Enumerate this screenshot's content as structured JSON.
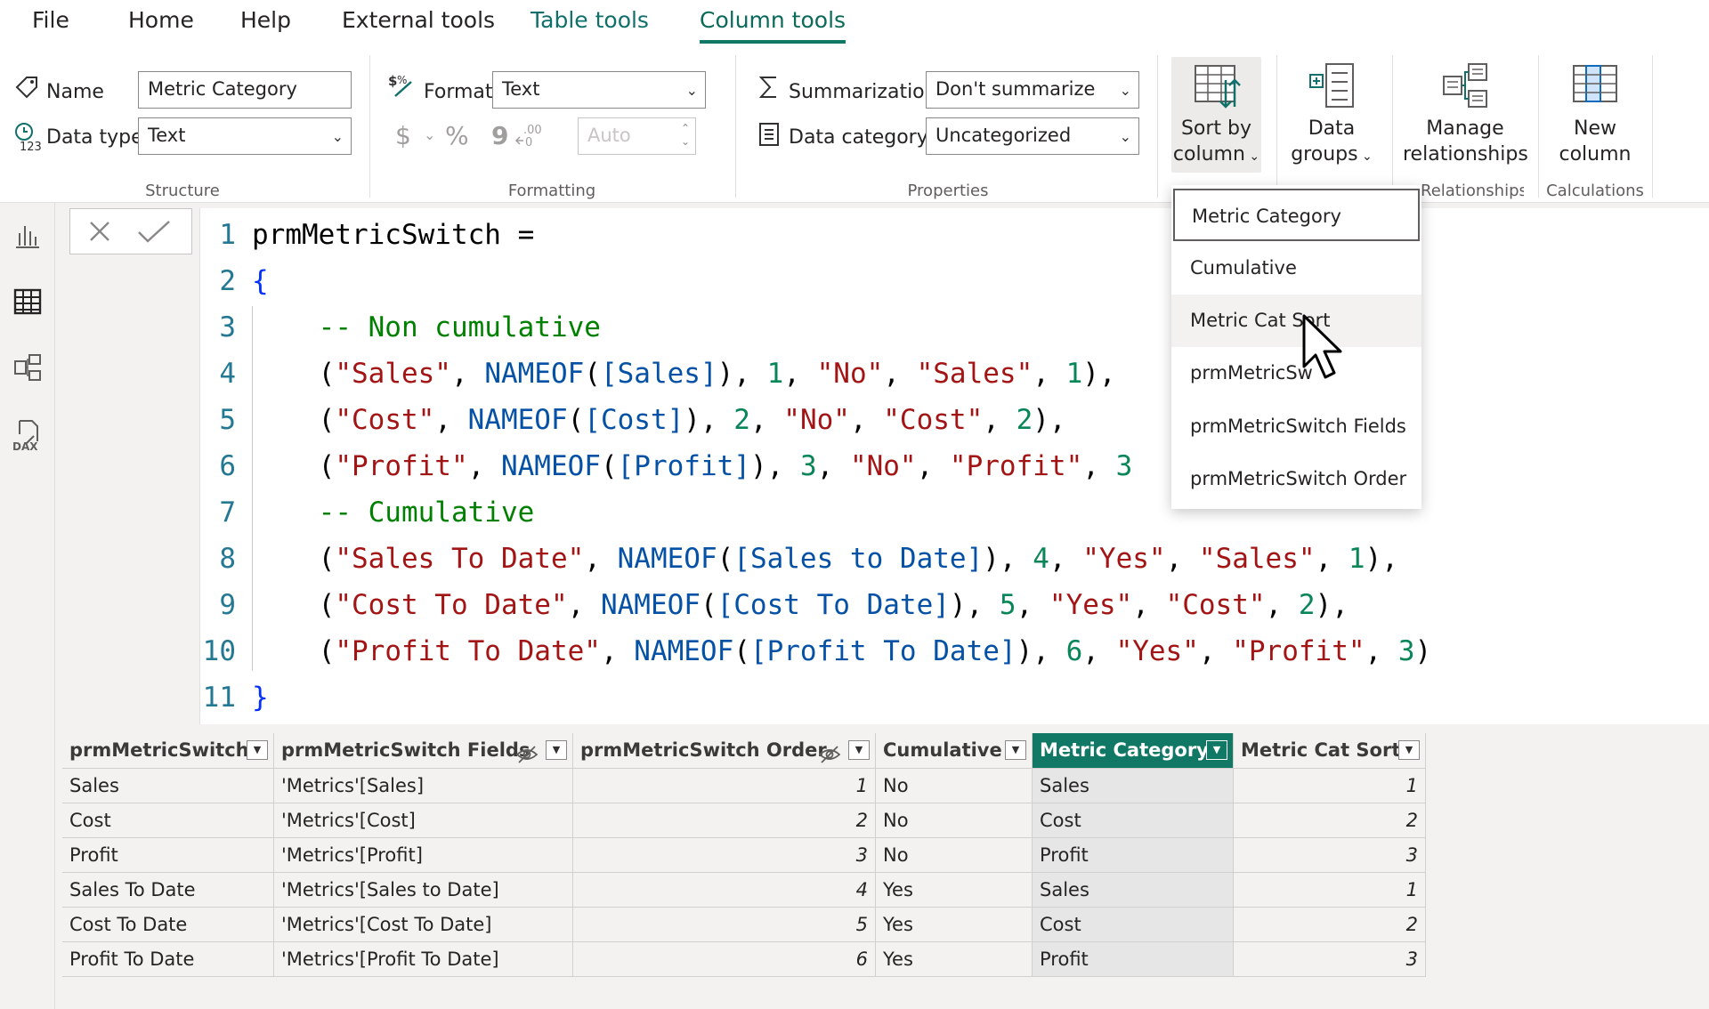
{
  "menu": {
    "items": [
      "File",
      "Home",
      "Help",
      "External tools",
      "Table tools",
      "Column tools"
    ]
  },
  "ribbon": {
    "structure": {
      "group_label": "Structure",
      "name_label": "Name",
      "name_value": "Metric Category",
      "datatype_label": "Data type",
      "datatype_value": "Text"
    },
    "formatting": {
      "group_label": "Formatting",
      "format_label": "Format",
      "format_value": "Text",
      "currency_symbol": "$",
      "percent_symbol": "%",
      "comma_symbol": "9",
      "auto_value": "Auto"
    },
    "properties": {
      "group_label": "Properties",
      "summarization_label": "Summarization",
      "summarization_value": "Don't summarize",
      "datacategory_label": "Data category",
      "datacategory_value": "Uncategorized"
    },
    "sort": {
      "line1": "Sort by",
      "line2": "column"
    },
    "groups": {
      "line1": "Data",
      "line2": "groups"
    },
    "relationships": {
      "line1": "Manage",
      "line2": "relationships",
      "group_label": "Relationships"
    },
    "calculations": {
      "line1": "New",
      "line2": "column",
      "group_label": "Calculations"
    }
  },
  "sort_dropdown": {
    "items": [
      "Metric Category",
      "Cumulative",
      "Metric Cat Sort",
      "prmMetricSw",
      "prmMetricSwitch Fields",
      "prmMetricSwitch Order"
    ],
    "selected": "Metric Category",
    "hovered": "Metric Cat Sort"
  },
  "editor": {
    "lines": [
      {
        "num": "1",
        "parts": [
          {
            "t": "prmMetricSwitch =",
            "c": "k"
          }
        ]
      },
      {
        "num": "2",
        "parts": [
          {
            "t": "{",
            "c": "b"
          }
        ]
      },
      {
        "num": "3",
        "parts": [
          {
            "t": "    ",
            "c": "k"
          },
          {
            "t": "-- Non cumulative",
            "c": "cm"
          }
        ]
      },
      {
        "num": "4",
        "parts": [
          {
            "t": "    (",
            "c": "k"
          },
          {
            "t": "\"Sales\"",
            "c": "s"
          },
          {
            "t": ", ",
            "c": "k"
          },
          {
            "t": "NAMEOF",
            "c": "f"
          },
          {
            "t": "(",
            "c": "k"
          },
          {
            "t": "[Sales]",
            "c": "f"
          },
          {
            "t": "), ",
            "c": "k"
          },
          {
            "t": "1",
            "c": "n"
          },
          {
            "t": ", ",
            "c": "k"
          },
          {
            "t": "\"No\"",
            "c": "s"
          },
          {
            "t": ", ",
            "c": "k"
          },
          {
            "t": "\"Sales\"",
            "c": "s"
          },
          {
            "t": ", ",
            "c": "k"
          },
          {
            "t": "1",
            "c": "n"
          },
          {
            "t": "),",
            "c": "k"
          }
        ]
      },
      {
        "num": "5",
        "parts": [
          {
            "t": "    (",
            "c": "k"
          },
          {
            "t": "\"Cost\"",
            "c": "s"
          },
          {
            "t": ", ",
            "c": "k"
          },
          {
            "t": "NAMEOF",
            "c": "f"
          },
          {
            "t": "(",
            "c": "k"
          },
          {
            "t": "[Cost]",
            "c": "f"
          },
          {
            "t": "), ",
            "c": "k"
          },
          {
            "t": "2",
            "c": "n"
          },
          {
            "t": ", ",
            "c": "k"
          },
          {
            "t": "\"No\"",
            "c": "s"
          },
          {
            "t": ", ",
            "c": "k"
          },
          {
            "t": "\"Cost\"",
            "c": "s"
          },
          {
            "t": ", ",
            "c": "k"
          },
          {
            "t": "2",
            "c": "n"
          },
          {
            "t": "),",
            "c": "k"
          }
        ]
      },
      {
        "num": "6",
        "parts": [
          {
            "t": "    (",
            "c": "k"
          },
          {
            "t": "\"Profit\"",
            "c": "s"
          },
          {
            "t": ", ",
            "c": "k"
          },
          {
            "t": "NAMEOF",
            "c": "f"
          },
          {
            "t": "(",
            "c": "k"
          },
          {
            "t": "[Profit]",
            "c": "f"
          },
          {
            "t": "), ",
            "c": "k"
          },
          {
            "t": "3",
            "c": "n"
          },
          {
            "t": ", ",
            "c": "k"
          },
          {
            "t": "\"No\"",
            "c": "s"
          },
          {
            "t": ", ",
            "c": "k"
          },
          {
            "t": "\"Profit\"",
            "c": "s"
          },
          {
            "t": ", ",
            "c": "k"
          },
          {
            "t": "3",
            "c": "n"
          }
        ]
      },
      {
        "num": "7",
        "parts": [
          {
            "t": "    ",
            "c": "k"
          },
          {
            "t": "-- Cumulative",
            "c": "cm"
          }
        ]
      },
      {
        "num": "8",
        "parts": [
          {
            "t": "    (",
            "c": "k"
          },
          {
            "t": "\"Sales To Date\"",
            "c": "s"
          },
          {
            "t": ", ",
            "c": "k"
          },
          {
            "t": "NAMEOF",
            "c": "f"
          },
          {
            "t": "(",
            "c": "k"
          },
          {
            "t": "[Sales to Date]",
            "c": "f"
          },
          {
            "t": "), ",
            "c": "k"
          },
          {
            "t": "4",
            "c": "n"
          },
          {
            "t": ", ",
            "c": "k"
          },
          {
            "t": "\"Yes\"",
            "c": "s"
          },
          {
            "t": ", ",
            "c": "k"
          },
          {
            "t": "\"Sales\"",
            "c": "s"
          },
          {
            "t": ", ",
            "c": "k"
          },
          {
            "t": "1",
            "c": "n"
          },
          {
            "t": "),",
            "c": "k"
          }
        ]
      },
      {
        "num": "9",
        "parts": [
          {
            "t": "    (",
            "c": "k"
          },
          {
            "t": "\"Cost To Date\"",
            "c": "s"
          },
          {
            "t": ", ",
            "c": "k"
          },
          {
            "t": "NAMEOF",
            "c": "f"
          },
          {
            "t": "(",
            "c": "k"
          },
          {
            "t": "[Cost To Date]",
            "c": "f"
          },
          {
            "t": "), ",
            "c": "k"
          },
          {
            "t": "5",
            "c": "n"
          },
          {
            "t": ", ",
            "c": "k"
          },
          {
            "t": "\"Yes\"",
            "c": "s"
          },
          {
            "t": ", ",
            "c": "k"
          },
          {
            "t": "\"Cost\"",
            "c": "s"
          },
          {
            "t": ", ",
            "c": "k"
          },
          {
            "t": "2",
            "c": "n"
          },
          {
            "t": "),",
            "c": "k"
          }
        ]
      },
      {
        "num": "10",
        "parts": [
          {
            "t": "    (",
            "c": "k"
          },
          {
            "t": "\"Profit To Date\"",
            "c": "s"
          },
          {
            "t": ", ",
            "c": "k"
          },
          {
            "t": "NAMEOF",
            "c": "f"
          },
          {
            "t": "(",
            "c": "k"
          },
          {
            "t": "[Profit To Date]",
            "c": "f"
          },
          {
            "t": "), ",
            "c": "k"
          },
          {
            "t": "6",
            "c": "n"
          },
          {
            "t": ", ",
            "c": "k"
          },
          {
            "t": "\"Yes\"",
            "c": "s"
          },
          {
            "t": ", ",
            "c": "k"
          },
          {
            "t": "\"Profit\"",
            "c": "s"
          },
          {
            "t": ", ",
            "c": "k"
          },
          {
            "t": "3",
            "c": "n"
          },
          {
            "t": ")",
            "c": "k"
          }
        ]
      },
      {
        "num": "11",
        "parts": [
          {
            "t": "}",
            "c": "b"
          }
        ]
      }
    ]
  },
  "table": {
    "columns": [
      {
        "name": "prmMetricSwitch",
        "hidden": false,
        "selected": false,
        "numeric": false
      },
      {
        "name": "prmMetricSwitch Fields",
        "hidden": true,
        "selected": false,
        "numeric": false
      },
      {
        "name": "prmMetricSwitch Order",
        "hidden": true,
        "selected": false,
        "numeric": true
      },
      {
        "name": "Cumulative",
        "hidden": false,
        "selected": false,
        "numeric": false
      },
      {
        "name": "Metric Category",
        "hidden": false,
        "selected": true,
        "numeric": false
      },
      {
        "name": "Metric Cat Sort",
        "hidden": false,
        "selected": false,
        "numeric": true
      }
    ],
    "rows": [
      [
        "Sales",
        "'Metrics'[Sales]",
        "1",
        "No",
        "Sales",
        "1"
      ],
      [
        "Cost",
        "'Metrics'[Cost]",
        "2",
        "No",
        "Cost",
        "2"
      ],
      [
        "Profit",
        "'Metrics'[Profit]",
        "3",
        "No",
        "Profit",
        "3"
      ],
      [
        "Sales To Date",
        "'Metrics'[Sales to Date]",
        "4",
        "Yes",
        "Sales",
        "1"
      ],
      [
        "Cost To Date",
        "'Metrics'[Cost To Date]",
        "5",
        "Yes",
        "Cost",
        "2"
      ],
      [
        "Profit To Date",
        "'Metrics'[Profit To Date]",
        "6",
        "Yes",
        "Profit",
        "3"
      ]
    ]
  },
  "colors": {
    "accent": "#117865",
    "context_tab": "#11706b"
  }
}
